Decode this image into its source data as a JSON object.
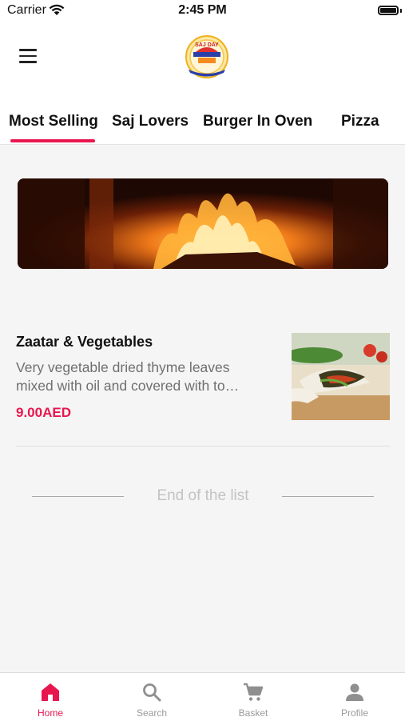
{
  "status_bar": {
    "carrier": "Carrier",
    "time": "2:45 PM",
    "icons": [
      "wifi-icon",
      "battery-icon"
    ]
  },
  "header": {
    "menu_icon": "hamburger-menu-icon",
    "logo": "restaurant-logo",
    "logo_text": "SAJ DAY"
  },
  "tabs": [
    {
      "label": "Most Selling",
      "active": true
    },
    {
      "label": "Saj Lovers",
      "active": false
    },
    {
      "label": "Burger In Oven",
      "active": false
    },
    {
      "label": "Pizza",
      "active": false
    }
  ],
  "banner": {
    "image": "fire-oven-banner"
  },
  "items": [
    {
      "title": "Zaatar & Vegetables",
      "description_line1": "Very vegetable dried thyme leaves",
      "description_line2": "mixed with oil and covered with to…",
      "price": "9.00AED",
      "image": "zaatar-wrap-photo"
    }
  ],
  "end_of_list": "End of the list",
  "bottom_nav": [
    {
      "label": "Home",
      "icon": "home-icon",
      "active": true
    },
    {
      "label": "Search",
      "icon": "search-icon",
      "active": false
    },
    {
      "label": "Basket",
      "icon": "cart-icon",
      "active": false
    },
    {
      "label": "Profile",
      "icon": "person-icon",
      "active": false
    }
  ],
  "colors": {
    "accent": "#e8164f",
    "background": "#f5f5f5",
    "muted_text": "#6f6f6f"
  }
}
